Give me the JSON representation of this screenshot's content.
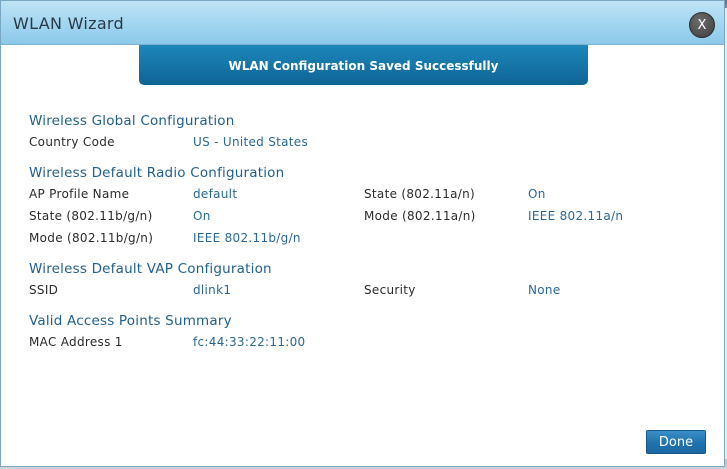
{
  "dialog": {
    "title": "WLAN Wizard",
    "close_label": "X",
    "banner": "WLAN Configuration Saved Successfully",
    "done_label": "Done"
  },
  "global": {
    "title": "Wireless Global Configuration",
    "country_code_label": "Country Code",
    "country_code_value": "US - United States"
  },
  "radio": {
    "title": "Wireless Default Radio Configuration",
    "ap_profile_label": "AP Profile Name",
    "ap_profile_value": "default",
    "state_a_label": "State (802.11a/n)",
    "state_a_value": "On",
    "state_b_label": "State (802.11b/g/n)",
    "state_b_value": "On",
    "mode_a_label": "Mode (802.11a/n)",
    "mode_a_value": "IEEE 802.11a/n",
    "mode_b_label": "Mode (802.11b/g/n)",
    "mode_b_value": "IEEE 802.11b/g/n"
  },
  "vap": {
    "title": "Wireless Default VAP Configuration",
    "ssid_label": "SSID",
    "ssid_value": "dlink1",
    "security_label": "Security",
    "security_value": "None"
  },
  "valid_ap": {
    "title": "Valid Access Points Summary",
    "mac_label": "MAC Address 1",
    "mac_value": "fc:44:33:22:11:00"
  }
}
